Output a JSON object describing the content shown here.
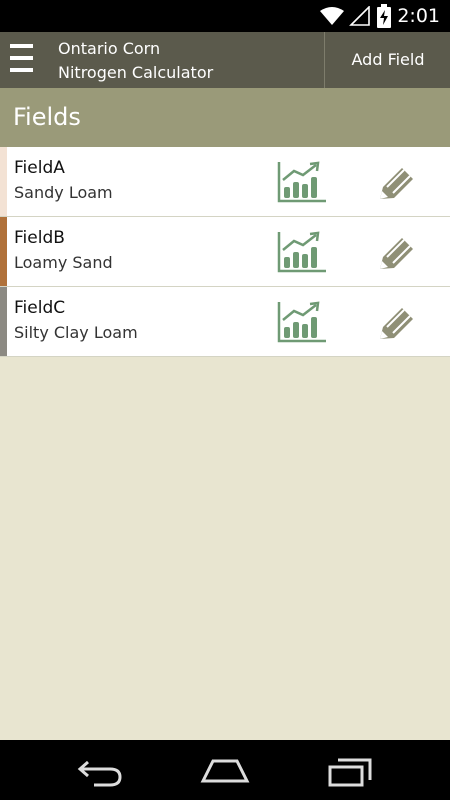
{
  "status": {
    "time": "2:01"
  },
  "app": {
    "title_line1": "Ontario Corn",
    "title_line2": "Nitrogen Calculator",
    "add_field_label": "Add Field"
  },
  "section": {
    "title": "Fields"
  },
  "fields": [
    {
      "name": "FieldA",
      "soil": "Sandy Loam",
      "swatch_color": "#f3e2d4"
    },
    {
      "name": "FieldB",
      "soil": "Loamy Sand",
      "swatch_color": "#b0713a"
    },
    {
      "name": "FieldC",
      "soil": "Silty Clay Loam",
      "swatch_color": "#8c8a83"
    }
  ],
  "icons": {
    "menu": "menu-icon",
    "chart": "bar-chart-trend-icon",
    "edit": "pencil-icon",
    "wifi": "wifi-icon",
    "signal": "signal-icon",
    "battery": "battery-charging-icon",
    "back": "back-icon",
    "home": "home-icon",
    "recents": "recents-icon"
  },
  "colors": {
    "app_bar": "#5b5a4c",
    "section_header": "#9a9a79",
    "background": "#e8e5d0",
    "chart_icon": "#6f9a74",
    "edit_icon": "#8f8f76"
  }
}
